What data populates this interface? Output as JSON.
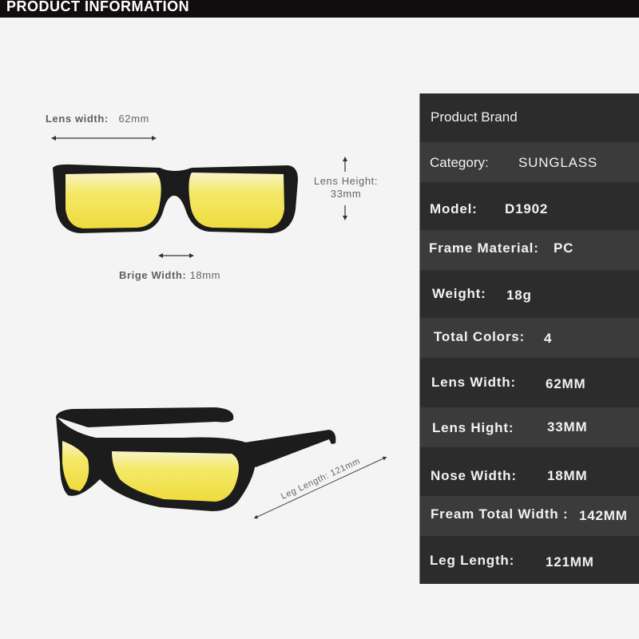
{
  "header": {
    "title": "PRODUCT INFORMATION"
  },
  "dimensions": {
    "lens_width_label": "Lens width:",
    "lens_width_value": "62mm",
    "lens_height_label": "Lens Height:",
    "lens_height_value": "33mm",
    "bridge_width_label": "Brige Width:",
    "bridge_width_value": "18mm",
    "leg_length_text": "Leg Length: 121mm"
  },
  "colors": {
    "lens": "#f3e45a",
    "frame": "#1b1b1b",
    "row_dark": "#2c2c2c",
    "row_light": "#3b3b3b"
  },
  "specs": [
    {
      "label": "Product Brand",
      "value": ""
    },
    {
      "label": "Category:",
      "value": "SUNGLASS"
    },
    {
      "label": "Model:",
      "value": "D1902"
    },
    {
      "label": "Frame Material:",
      "value": "PC"
    },
    {
      "label": "Weight:",
      "value": "18g"
    },
    {
      "label": "Total Colors:",
      "value": "4"
    },
    {
      "label": "Lens Width:",
      "value": "62MM"
    },
    {
      "label": "Lens Hight:",
      "value": "33MM"
    },
    {
      "label": "Nose Width:",
      "value": "18MM"
    },
    {
      "label": "Fream Total Width :",
      "value": "142MM"
    },
    {
      "label": "Leg Length:",
      "value": "121MM"
    }
  ]
}
